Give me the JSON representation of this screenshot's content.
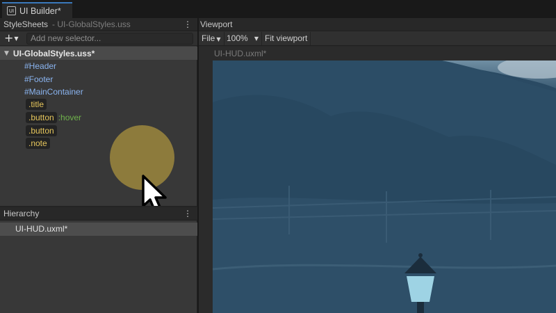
{
  "window": {
    "tab_label": "UI Builder*",
    "tab_icon": "ui-builder-icon",
    "tab_icon_text": "UI"
  },
  "stylesheets": {
    "title": "StyleSheets",
    "subtitle": "- UI-GlobalStyles.uss",
    "add_label": "+",
    "selector_placeholder": "Add new selector...",
    "root_item": "UI-GlobalStyles.uss*",
    "selectors": [
      {
        "kind": "id",
        "text": "#Header"
      },
      {
        "kind": "id",
        "text": "#Footer"
      },
      {
        "kind": "id",
        "text": "#MainContainer"
      },
      {
        "kind": "class",
        "text": ".title"
      },
      {
        "kind": "class",
        "text": ".button",
        "pseudo": ":hover"
      },
      {
        "kind": "class",
        "text": ".button"
      },
      {
        "kind": "class",
        "text": ".note"
      }
    ]
  },
  "hierarchy": {
    "title": "Hierarchy",
    "items": [
      "UI-HUD.uxml*"
    ]
  },
  "viewport": {
    "title": "Viewport",
    "file_menu": "File",
    "zoom": "100%",
    "fit_button": "Fit viewport",
    "document_label": "UI-HUD.uxml*"
  },
  "colors": {
    "accent_tab": "#3a79bb",
    "id_selector": "#8ab4f0",
    "class_selector": "#e6c65c",
    "pseudo_class": "#6fb34b",
    "click_indicator": "#8d7b3c",
    "scene_tint": "#2a4a63"
  }
}
